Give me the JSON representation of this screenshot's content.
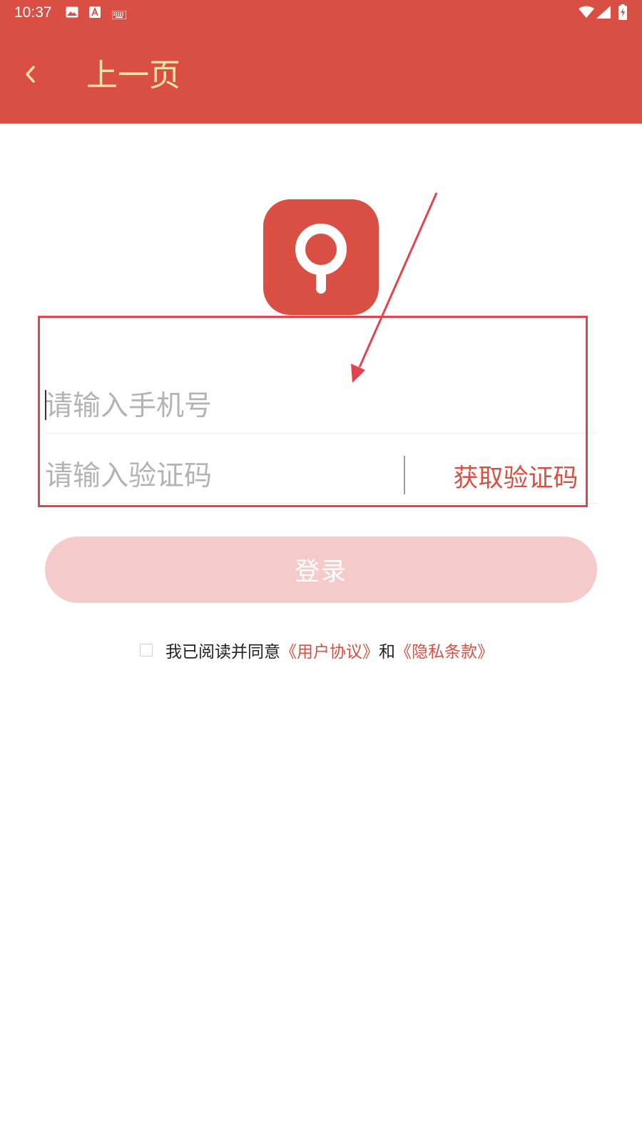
{
  "status_bar": {
    "time": "10:37",
    "left_icons": [
      "image-icon",
      "text-a-icon",
      "keyboard-icon"
    ],
    "right_icons": [
      "wifi-icon",
      "signal-icon",
      "battery-charging-icon"
    ]
  },
  "app_bar": {
    "back_icon": "chevron-left-icon",
    "title": "上一页",
    "background_color": "#d94f43",
    "title_color": "#f7e3a8"
  },
  "logo": {
    "icon": "location-pin-icon",
    "background_color": "#d94f43"
  },
  "form": {
    "phone_placeholder": "请输入手机号",
    "phone_value": "",
    "code_placeholder": "请输入验证码",
    "code_value": "",
    "get_code_label": "获取验证码"
  },
  "login_button": {
    "label": "登录",
    "background_color": "#f4cbca"
  },
  "agreement": {
    "checked": false,
    "prefix": "我已阅读并同意",
    "user_agreement": "《用户协议》",
    "conjunction": "和",
    "privacy_policy": "《隐私条款》",
    "link_color": "#d94f43"
  },
  "annotation": {
    "color": "#e5434a"
  }
}
